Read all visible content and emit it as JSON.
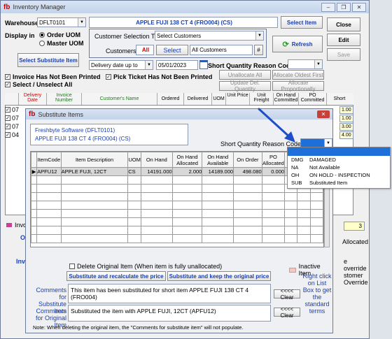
{
  "main": {
    "title": "Inventory Manager",
    "warehouse_label": "Warehouse",
    "warehouse_value": "DFLT0101",
    "item_title": "APPLE FUJI 138 CT 4 (FRO004) (CS)",
    "select_item": "Select Item",
    "display_in": "Display in",
    "order_uom": "Order UOM",
    "master_uom": "Master UOM",
    "substitute_item": "Select Substitute Item",
    "customer_selection_type_label": "Customer Selection Type",
    "customer_selection_type_value": "Select Customers",
    "customers_label": "Customers:",
    "customers_all": "All",
    "customers_select": "Select",
    "customers_value": "All Customers",
    "delivery_date_label": "Delivery date up to",
    "delivery_date_value": "05/01/2023",
    "sq_reason_label": "Short Quantity Reason Code",
    "invoice_not_printed": "Invoice Has Not Been Printed",
    "pick_ticket_not_printed": "Pick Ticket Has Not Been Printed",
    "select_unselect_all": "Select / Unselect All",
    "unallocate_all": "Unallocate All",
    "allocate_oldest_first": "Allocate Oldest First",
    "update_del_qty": "Update Del. Quantity",
    "allocate_proportional": "Allocate Proportionally",
    "close": "Close",
    "edit": "Edit",
    "save": "Save",
    "refresh": "Refresh",
    "columns": [
      "Delivery Date",
      "Invoice Number",
      "Customer's Name",
      "Ordered",
      "Delivered",
      "UOM",
      "Unit Price",
      "Unit Freight",
      "On Hand Committed",
      "PO Committed",
      "Short"
    ],
    "rows_date": [
      "07",
      "07",
      "07",
      "04"
    ],
    "short_values": [
      "1.00",
      "1.00",
      "3.00",
      "4.00"
    ],
    "invo_fragment": "Invo",
    "o_fragment": "O",
    "inv_fragment": "Inv",
    "right_value": "3",
    "allocated": "Allocated",
    "override_lines": [
      "e override",
      "stomer",
      "Override"
    ]
  },
  "dialog": {
    "title": "Substitute Items",
    "company": "Freshbyte Software (DFLT0101)",
    "item": "APPLE FUJI 138 CT 4 (FRO004) (CS)",
    "sq_reason_label": "Short Quantity Reason Code",
    "columns": [
      "ItemCode",
      "Item Description",
      "UOM",
      "On Hand",
      "On Hand Allocated",
      "On Hand Available",
      "On Order",
      "PO Allocated"
    ],
    "row": {
      "code": "APFU12",
      "desc": "APPLE FUJI, 12CT",
      "uom": "CS",
      "on_hand": "14191.000",
      "allocated": "2.000",
      "available": "14189.000",
      "on_order": "498.080",
      "po_allocated": "0.000"
    },
    "delete_original": "Delete Original Item (When item is fully unallocated)",
    "inactive_item": "Inactive Item",
    "substitute_recalc": "Substitute and recalculate the price",
    "substitute_keep": "Substitute and keep the original price",
    "comments_sub_label": "Comments for Substitute Item",
    "comments_sub_value": "This item has been substituted for short item APPLE FUJI 138 CT 4 (FRO004)",
    "comments_orig_label": "Comments for Original Item",
    "comments_orig_value": "Substituted the item with APPLE FUJI, 12CT (APFU12)",
    "clear": "<<<< Clear",
    "hint": "Right click on List Box to get the standard terms",
    "note": "Note: When deleting the original item, the \"Comments for substitute item\" will not populate."
  },
  "dropdown": {
    "options": [
      {
        "code": "DMG",
        "label": "DAMAGED"
      },
      {
        "code": "NA",
        "label": "Not Available"
      },
      {
        "code": "OH",
        "label": "ON HOLD - INSPECTION"
      },
      {
        "code": "SUB",
        "label": "Substituted Item"
      }
    ]
  },
  "colors": {
    "accent": "#1a3fb0",
    "arrow": "#1f4fc8",
    "highlight": "#1e6fd9",
    "red": "#cc0000"
  }
}
